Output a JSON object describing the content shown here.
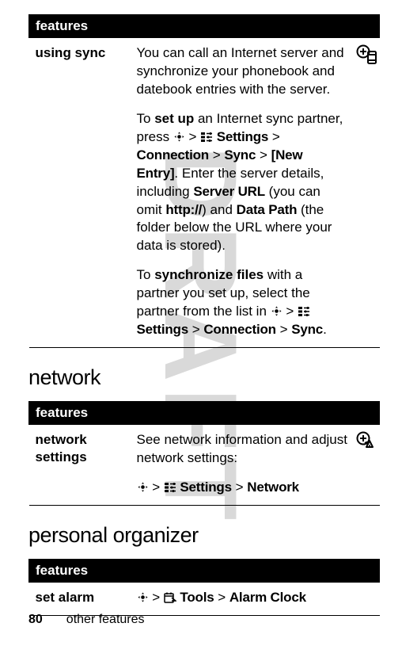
{
  "table1": {
    "header": "features",
    "left": "using sync",
    "p1a": "You can call an Internet server and synchronize your phonebook and datebook entries with the server.",
    "p2_pre": "To ",
    "p2_bold": "set up",
    "p2_post": " an Internet sync partner, press ",
    "p2_settings": " Settings",
    "gt": " > ",
    "p2_conn": "Connection",
    "p2_sync": "Sync",
    "p2_newentry": "[New Entry]",
    "p2_mid": ". Enter the server details, including ",
    "p2_serverurl": "Server URL",
    "p2_mid2": " (you can omit ",
    "p2_http": "http://",
    "p2_mid3": ") and ",
    "p2_datapath": "Data Path",
    "p2_end": " (the folder below the URL where your data is stored).",
    "p3_pre": "To ",
    "p3_bold": "synchronize files",
    "p3_post": " with a partner you set up, select the partner from the list in ",
    "p3_settings": " Settings",
    "p3_conn": "Connection",
    "p3_sync": "Sync",
    "dot": "."
  },
  "heading_network": "network",
  "table2": {
    "header": "features",
    "left": "network settings",
    "desc": "See network information and adjust network settings:",
    "settings": " Settings",
    "gt": " > ",
    "network": "Network"
  },
  "heading_personal": "personal organizer",
  "table3": {
    "header": "features",
    "left": "set alarm",
    "tools": " Tools",
    "gt": " > ",
    "alarm": "Alarm Clock"
  },
  "footer": {
    "page": "80",
    "text": "other features"
  }
}
